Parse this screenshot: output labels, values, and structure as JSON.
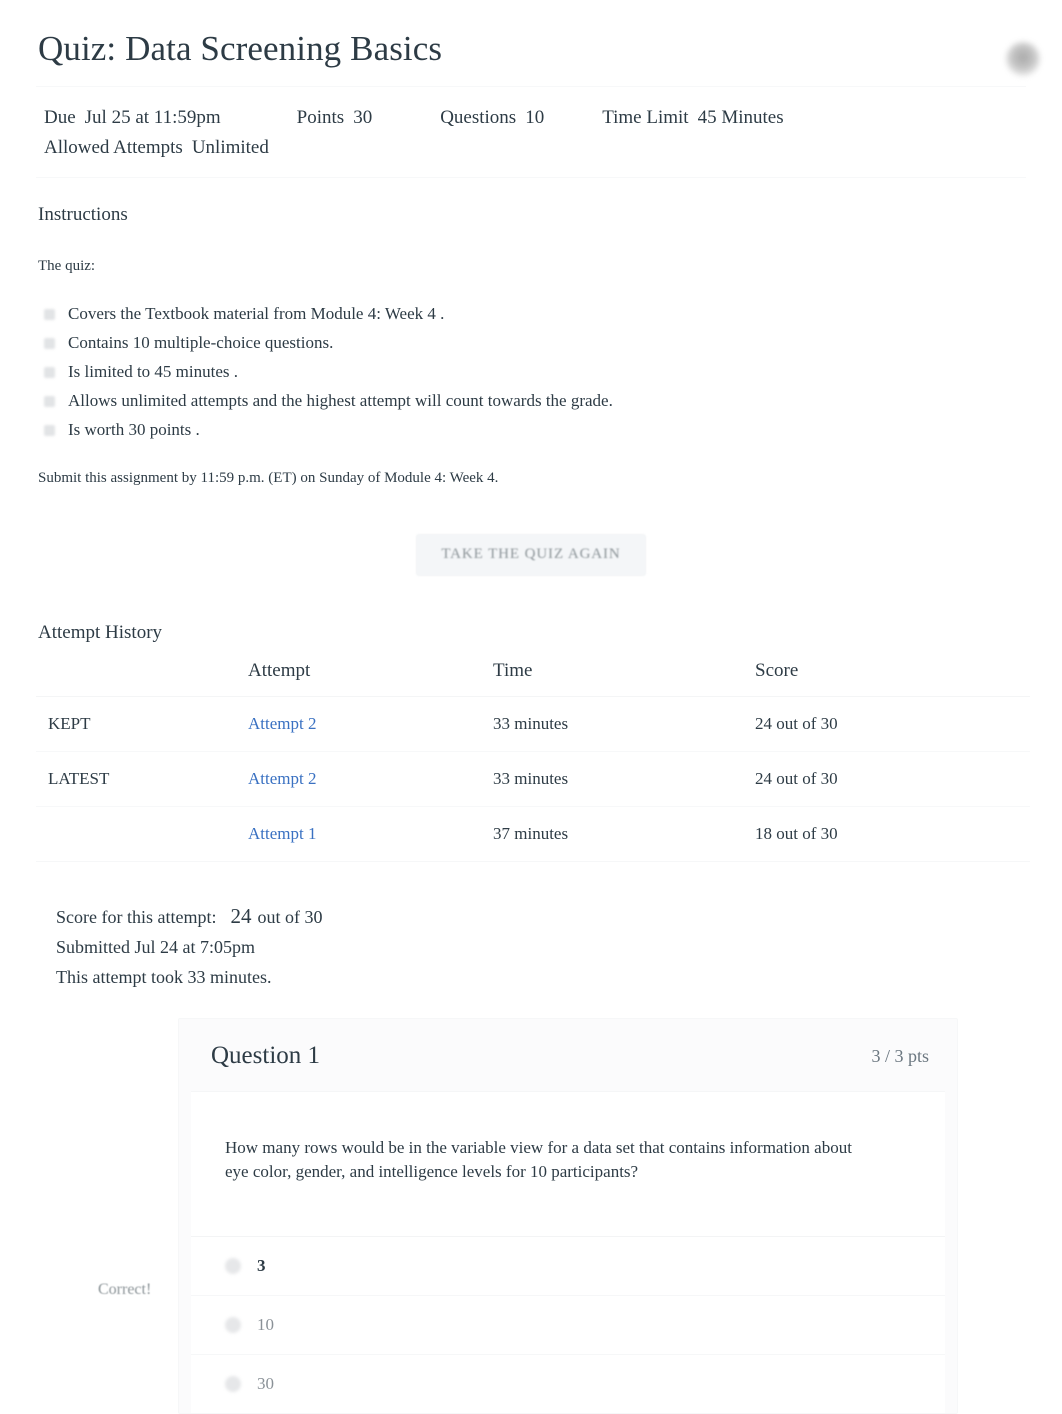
{
  "header": {
    "title": "Quiz: Data Screening Basics",
    "avatar_icon": "user-avatar-icon"
  },
  "meta": {
    "due_label": "Due",
    "due_value": "Jul 25 at 11:59pm",
    "points_label": "Points",
    "points_value": "30",
    "questions_label": "Questions",
    "questions_value": "10",
    "time_limit_label": "Time Limit",
    "time_limit_value": "45 Minutes",
    "allowed_attempts_label": "Allowed Attempts",
    "allowed_attempts_value": "Unlimited"
  },
  "instructions": {
    "heading": "Instructions",
    "intro": "The quiz:",
    "items": [
      "Covers the   Textbook   material from   Module 4: Week 4   .",
      "Contains   10 multiple-choice     questions.",
      "Is limited  to 45 minutes   .",
      "Allows  unlimited  attempts    and the   highest   attempt will count towards the grade.",
      "Is worth 30 points    ."
    ],
    "submit_note": "Submit this assignment by 11:59 p.m. (ET) on Sunday of Module 4: Week 4."
  },
  "actions": {
    "take_quiz_again": "TAKE THE QUIZ AGAIN"
  },
  "attempt_history": {
    "heading": "Attempt History",
    "columns": [
      "",
      "Attempt",
      "Time",
      "Score"
    ],
    "rows": [
      {
        "label": "KEPT",
        "attempt": "Attempt 2",
        "time": "33 minutes",
        "score": "24 out of 30"
      },
      {
        "label": "LATEST",
        "attempt": "Attempt 2",
        "time": "33 minutes",
        "score": "24 out of 30"
      },
      {
        "label": "",
        "attempt": "Attempt 1",
        "time": "37 minutes",
        "score": "18 out of 30"
      }
    ]
  },
  "attempt_summary": {
    "score_label": "Score for this attempt:",
    "score_value": "24",
    "score_suffix": "out of 30",
    "submitted": "Submitted Jul 24 at 7:05pm",
    "duration": "This attempt took 33 minutes."
  },
  "question": {
    "title": "Question 1",
    "points": "3 / 3 pts",
    "text": "How many rows would be in the variable view for a data set that contains information about eye color, gender, and intelligence levels for 10 participants?",
    "result_tag": "Correct!",
    "answers": [
      {
        "text": "3",
        "selected": true
      },
      {
        "text": "10",
        "selected": false
      },
      {
        "text": "30",
        "selected": false
      }
    ]
  },
  "colors": {
    "link": "#3a71c2",
    "text": "#2d3b45",
    "muted": "#8d9599",
    "card_bg": "#fbfbfc",
    "divider": "#f6f7f8"
  }
}
